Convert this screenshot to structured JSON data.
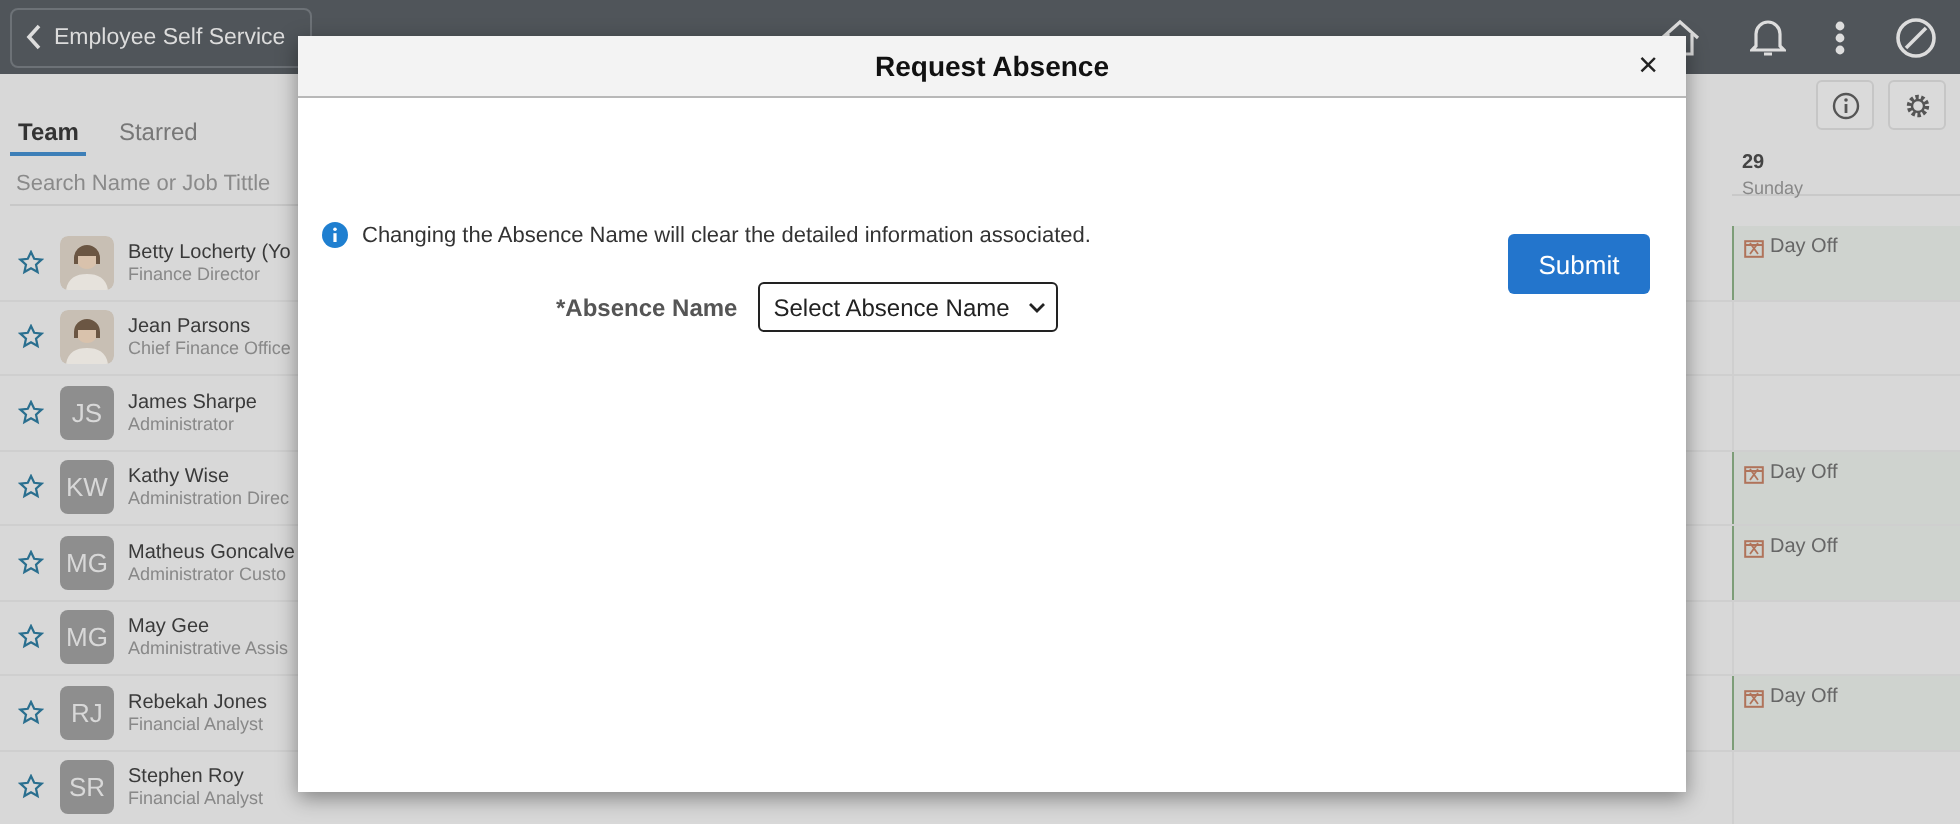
{
  "header": {
    "back_button": "Employee Self Service"
  },
  "tabs": [
    {
      "label": "Team",
      "selected": true
    },
    {
      "label": "Starred",
      "selected": false
    }
  ],
  "search": {
    "placeholder": "Search Name or Job Tittle"
  },
  "calendar": {
    "date": "29",
    "weekday": "Sunday"
  },
  "team": [
    {
      "name": "Betty Locherty (Yo",
      "title": "Finance Director",
      "starred": false,
      "entry": "Day Off"
    },
    {
      "name": "Jean Parsons",
      "title": "Chief Finance Office",
      "starred": false
    },
    {
      "name": "James Sharpe",
      "title": "Administrator",
      "starred": false,
      "avatar": {
        "kind": "initials",
        "text": "JS"
      }
    },
    {
      "name": "Kathy Wise",
      "title": "Administration Direc",
      "starred": false,
      "avatar": {
        "kind": "initials",
        "text": "KW"
      },
      "entry": "Day Off"
    },
    {
      "name": "Matheus Goncalve",
      "title": "Administrator Custo",
      "starred": false,
      "avatar": {
        "kind": "initials",
        "text": "MG"
      },
      "entry": "Day Off"
    },
    {
      "name": "May Gee",
      "title": "Administrative Assis",
      "starred": false,
      "avatar": {
        "kind": "initials",
        "text": "MG"
      }
    },
    {
      "name": "Rebekah Jones",
      "title": "Financial Analyst",
      "starred": false,
      "avatar": {
        "kind": "initials",
        "text": "RJ"
      },
      "entry": "Day Off"
    },
    {
      "name": "Stephen Roy",
      "title": "Financial Analyst",
      "starred": false,
      "avatar": {
        "kind": "initials",
        "text": "SR"
      }
    }
  ],
  "dialog": {
    "title": "Request Absence",
    "close": "×",
    "message": "Changing the Absence Name will clear the detailed information associated.",
    "field": {
      "label": "*Absence Name",
      "value": "Select Absence Name"
    },
    "submit": "Submit"
  }
}
